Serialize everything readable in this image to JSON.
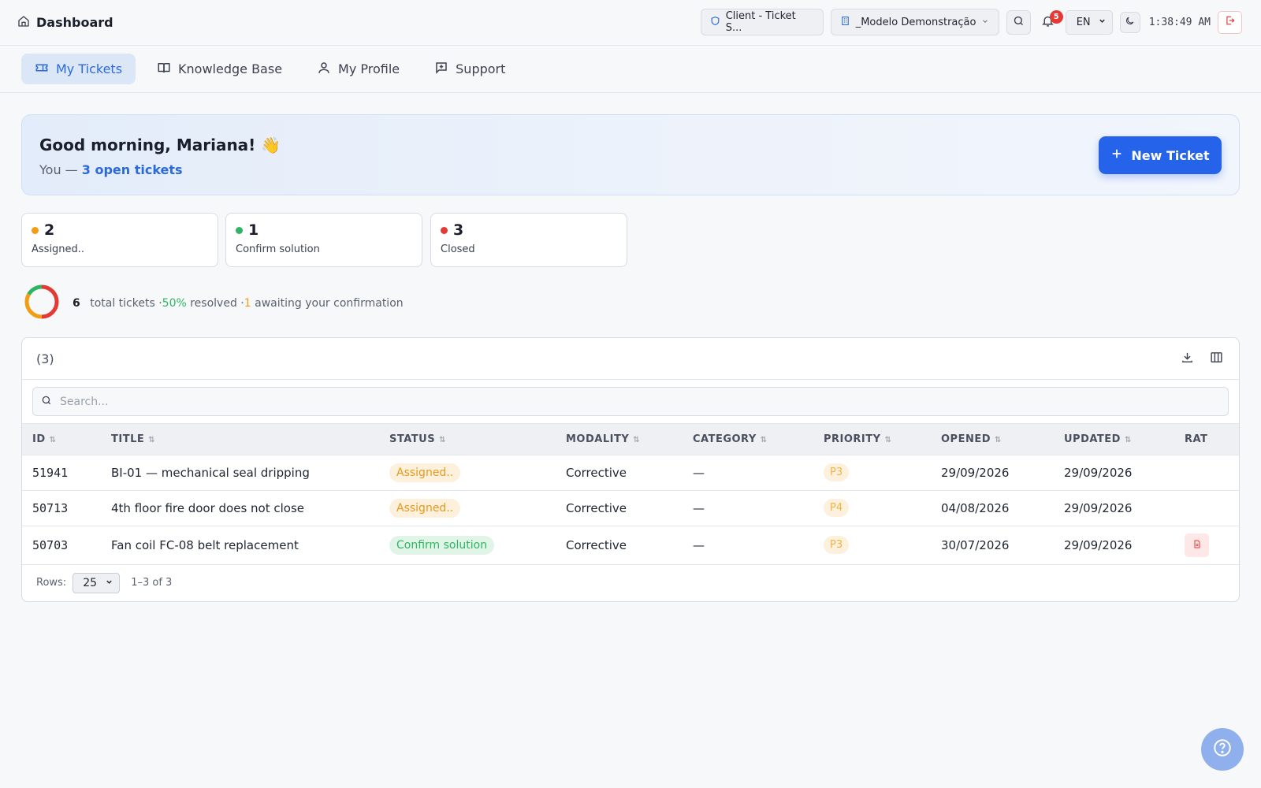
{
  "header": {
    "title": "Dashboard",
    "client_label": "Client - Ticket S...",
    "model_label": "_Modelo Demonstração",
    "notification_count": "5",
    "language": "EN",
    "time": "1:38:49 AM"
  },
  "nav": {
    "tabs": [
      {
        "label": "My Tickets",
        "icon": "ticket-icon",
        "active": true
      },
      {
        "label": "Knowledge Base",
        "icon": "book-icon",
        "active": false
      },
      {
        "label": "My Profile",
        "icon": "user-icon",
        "active": false
      },
      {
        "label": "Support",
        "icon": "message-plus-icon",
        "active": false
      }
    ]
  },
  "hero": {
    "greeting": "Good morning, Mariana! 👋",
    "sub_prefix": "You —",
    "sub_link": "3 open tickets",
    "new_ticket_label": "New Ticket"
  },
  "stats": [
    {
      "value": "2",
      "label": "Assigned..",
      "color": "#f39c12"
    },
    {
      "value": "1",
      "label": "Confirm solution",
      "color": "#2fb463"
    },
    {
      "value": "3",
      "label": "Closed",
      "color": "#e53935"
    }
  ],
  "summary": {
    "total": "6",
    "total_label": "total tickets",
    "sep1": "·",
    "resolved_pct": "50%",
    "resolved_label": "resolved",
    "sep2": "·",
    "awaiting_count": "1",
    "awaiting_label": "awaiting your confirmation"
  },
  "table": {
    "count": "(3)",
    "search_placeholder": "Search...",
    "columns": [
      "ID",
      "TITLE",
      "STATUS",
      "MODALITY",
      "CATEGORY",
      "PRIORITY",
      "OPENED",
      "UPDATED",
      "RAT"
    ],
    "rows": [
      {
        "id": "51941",
        "title": "BI-01 — mechanical seal dripping",
        "status": "Assigned..",
        "modality": "Corrective",
        "category": "—",
        "priority": "P3",
        "opened": "29/09/2026",
        "updated": "29/09/2026"
      },
      {
        "id": "50713",
        "title": "4th floor fire door does not close",
        "status": "Assigned..",
        "modality": "Corrective",
        "category": "—",
        "priority": "P4",
        "opened": "04/08/2026",
        "updated": "29/09/2026"
      },
      {
        "id": "50703",
        "title": "Fan coil FC-08 belt replacement",
        "status": "Confirm solution",
        "modality": "Corrective",
        "category": "—",
        "priority": "P3",
        "opened": "30/07/2026",
        "updated": "29/09/2026"
      }
    ],
    "rows_label": "Rows:",
    "rows_per_page": "25",
    "range": "1–3 of 3"
  },
  "colors": {
    "accent": "#2563eb",
    "assigned": "#f39c12",
    "confirm": "#2fb463",
    "closed": "#e53935"
  }
}
